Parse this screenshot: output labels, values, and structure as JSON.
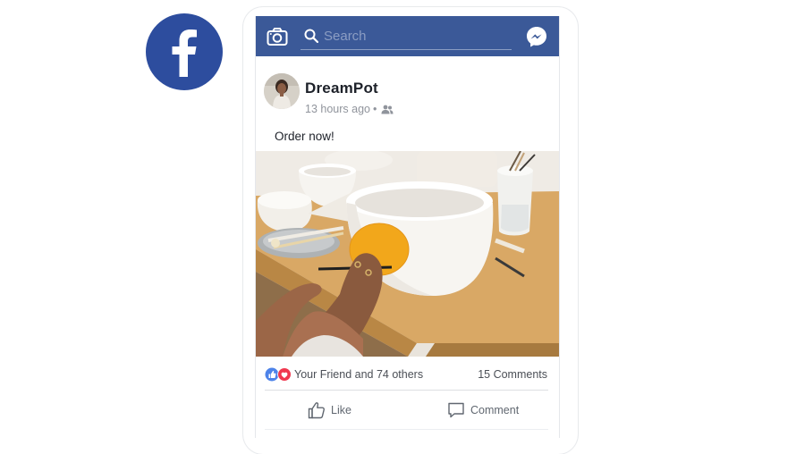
{
  "brand": {
    "logo_icon": "facebook-logo-icon",
    "color": "#2d4d9e"
  },
  "topbar": {
    "background": "#3b5998",
    "camera_icon": "camera-icon",
    "search": {
      "placeholder": "Search",
      "value": ""
    },
    "messenger_icon": "messenger-icon"
  },
  "post": {
    "author": "DreamPot",
    "time": "13 hours ago",
    "separator": "•",
    "audience_icon": "friends-icon",
    "text": "Order now!",
    "image_alt": "Hands painting an orange circle on a white ceramic bowl on a wooden table",
    "reactions": {
      "icons": [
        "like-reaction-icon",
        "love-reaction-icon"
      ],
      "text": "Your Friend and 74 others"
    },
    "comments_count": "15 Comments",
    "actions": {
      "like_label": "Like",
      "comment_label": "Comment"
    }
  }
}
